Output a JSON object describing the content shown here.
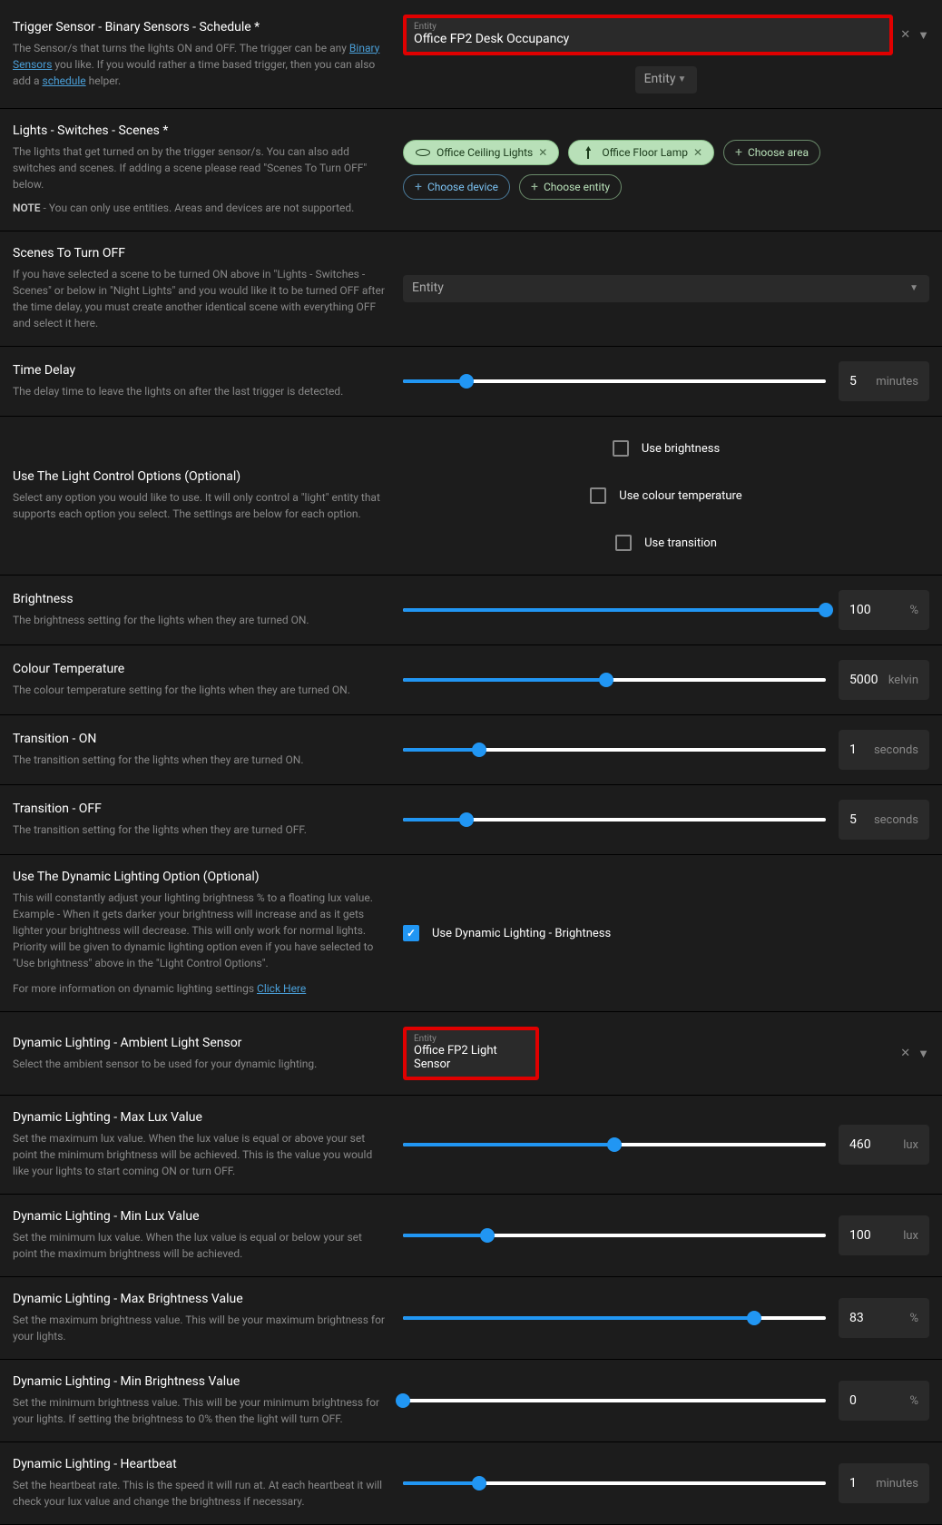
{
  "triggerSensor": {
    "title": "Trigger Sensor - Binary Sensors - Schedule *",
    "descPre": "The Sensor/s that turns the lights ON and OFF. The trigger can be any ",
    "descLink1": "Binary Sensors",
    "descMid": " you like. If you would rather a time based trigger, then you can also add a ",
    "descLink2": "schedule",
    "descPost": " helper.",
    "entityLabel": "Entity",
    "entityValue": "Office FP2 Desk Occupancy",
    "entity2Placeholder": "Entity"
  },
  "lights": {
    "title": "Lights - Switches - Scenes *",
    "desc": "The lights that get turned on by the trigger sensor/s. You can also add switches and scenes. If adding a scene please read \"Scenes To Turn OFF\" below.",
    "noteLabel": "NOTE",
    "noteText": " - You can only use entities. Areas and devices are not supported.",
    "chip1": "Office Ceiling Lights",
    "chip2": "Office Floor Lamp",
    "chooseArea": "Choose area",
    "chooseDevice": "Choose device",
    "chooseEntity": "Choose entity"
  },
  "scenesOff": {
    "title": "Scenes To Turn OFF",
    "desc": "If you have selected a scene to be turned ON above in \"Lights - Switches - Scenes\" or below in \"Night Lights\" and you would like it to be turned OFF after the time delay, you must create another identical scene with everything OFF and select it here.",
    "placeholder": "Entity"
  },
  "timeDelay": {
    "title": "Time Delay",
    "desc": "The delay time to leave the lights on after the last trigger is detected.",
    "value": "5",
    "unit": "minutes",
    "pct": 15
  },
  "lightControl": {
    "title": "Use The Light Control Options (Optional)",
    "desc": "Select any option you would like to use. It will only control a \"light\" entity that supports each option you select. The settings are below for each option.",
    "cb1": "Use brightness",
    "cb2": "Use colour temperature",
    "cb3": "Use transition"
  },
  "brightness": {
    "title": "Brightness",
    "desc": "The brightness setting for the lights when they are turned ON.",
    "value": "100",
    "unit": "%",
    "pct": 100
  },
  "colourTemp": {
    "title": "Colour Temperature",
    "desc": "The colour temperature setting for the lights when they are turned ON.",
    "value": "5000",
    "unit": "kelvin",
    "pct": 48
  },
  "transOn": {
    "title": "Transition - ON",
    "desc": "The transition setting for the lights when they are turned ON.",
    "value": "1",
    "unit": "seconds",
    "pct": 18
  },
  "transOff": {
    "title": "Transition - OFF",
    "desc": "The transition setting for the lights when they are turned OFF.",
    "value": "5",
    "unit": "seconds",
    "pct": 15
  },
  "dynamic": {
    "title": "Use The Dynamic Lighting Option (Optional)",
    "desc": "This will constantly adjust your lighting brightness % to a floating lux value. Example - When it gets darker your brightness will increase and as it gets lighter your brightness will decrease. This will only work for normal lights. Priority will be given to dynamic lighting option even if you have selected to \"Use brightness\" above in the \"Light Control Options\".",
    "moreInfo": "For more information on dynamic lighting settings ",
    "clickHere": "Click Here",
    "cb": "Use Dynamic Lighting - Brightness"
  },
  "ambientSensor": {
    "title": "Dynamic Lighting - Ambient Light Sensor",
    "desc": "Select the ambient sensor to be used for your dynamic lighting.",
    "entityLabel": "Entity",
    "entityValue": "Office FP2 Light Sensor"
  },
  "maxLux": {
    "title": "Dynamic Lighting - Max Lux Value",
    "desc": "Set the maximum lux value. When the lux value is equal or above your set point the minimum brightness will be achieved. This is the value you would like your lights to start coming ON or turn OFF.",
    "value": "460",
    "unit": "lux",
    "pct": 50
  },
  "minLux": {
    "title": "Dynamic Lighting - Min Lux Value",
    "desc": "Set the minimum lux value. When the lux value is equal or below your set point the maximum brightness will be achieved.",
    "value": "100",
    "unit": "lux",
    "pct": 20
  },
  "maxBright": {
    "title": "Dynamic Lighting - Max Brightness Value",
    "desc": "Set the maximum brightness value. This will be your maximum brightness for your lights.",
    "value": "83",
    "unit": "%",
    "pct": 83
  },
  "minBright": {
    "title": "Dynamic Lighting - Min Brightness Value",
    "desc": "Set the minimum brightness value. This will be your minimum brightness for your lights. If setting the brightness to 0% then the light will turn OFF.",
    "value": "0",
    "unit": "%",
    "pct": 0
  },
  "heartbeat": {
    "title": "Dynamic Lighting - Heartbeat",
    "desc": "Set the heartbeat rate. This is the speed it will run at. At each heartbeat it will check your lux value and change the brightness if necessary.",
    "value": "1",
    "unit": "minutes",
    "pct": 18
  }
}
